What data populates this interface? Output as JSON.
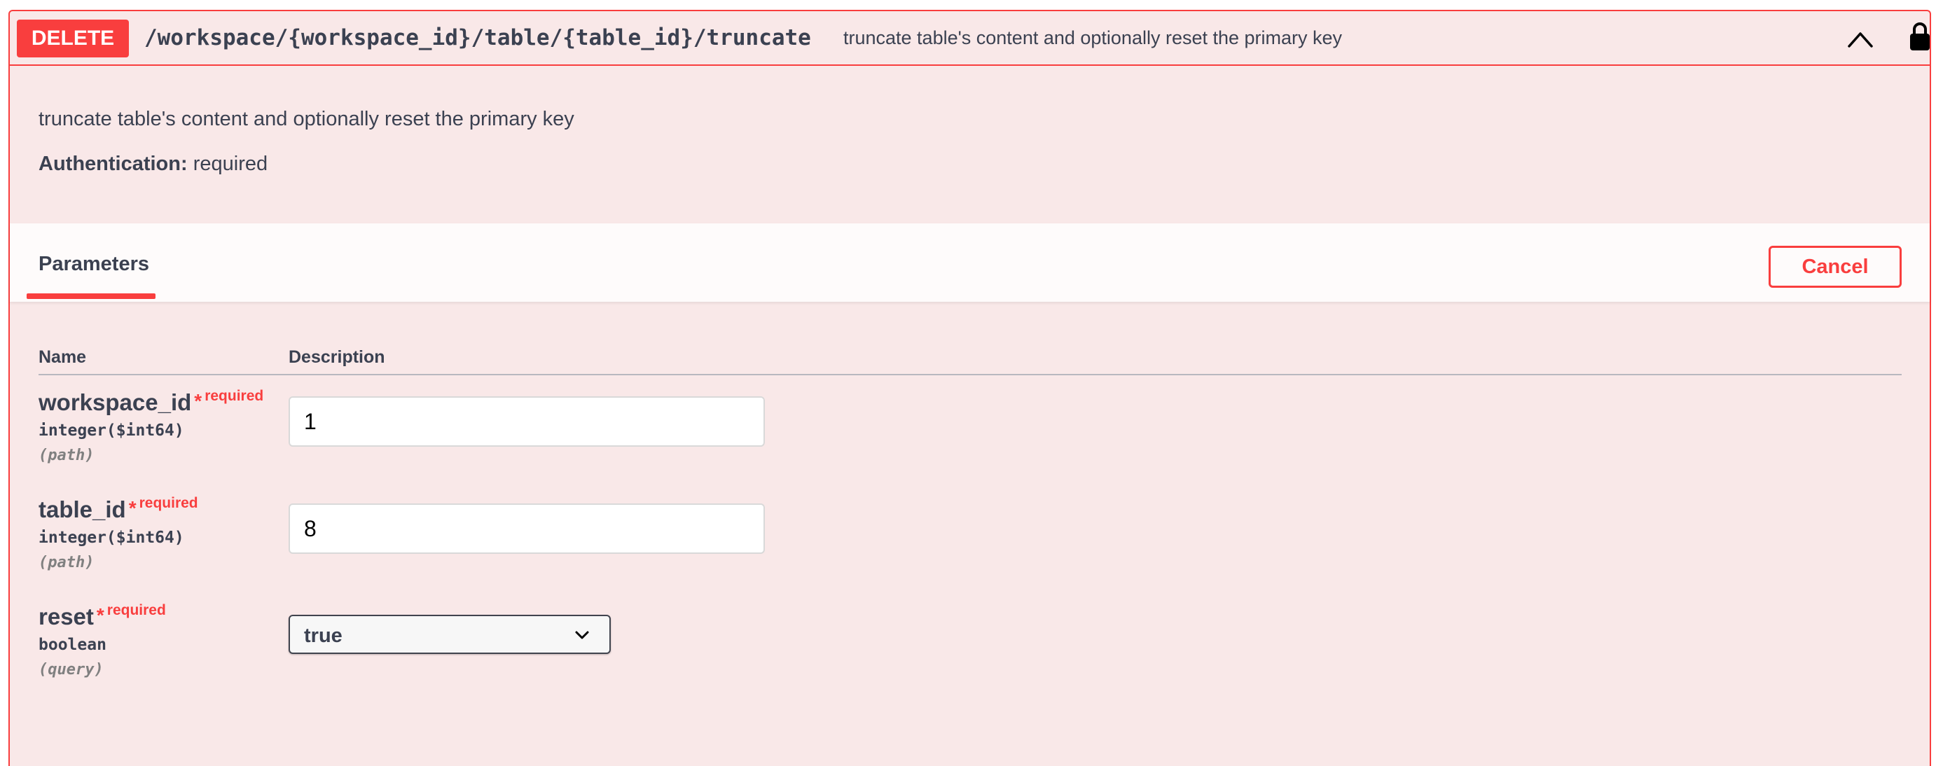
{
  "summary": {
    "method": "DELETE",
    "path": "/workspace/{workspace_id}/table/{table_id}/truncate",
    "description": "truncate table's content and optionally reset the primary key"
  },
  "description": "truncate table's content and optionally reset the primary key",
  "auth": {
    "label": "Authentication:",
    "value": "required"
  },
  "tabs": {
    "parameters": "Parameters",
    "cancel": "Cancel"
  },
  "columns": {
    "name": "Name",
    "description": "Description"
  },
  "parameters": [
    {
      "name": "workspace_id",
      "required": "required",
      "type": "integer($int64)",
      "in": "(path)",
      "value": "1"
    },
    {
      "name": "table_id",
      "required": "required",
      "type": "integer($int64)",
      "in": "(path)",
      "value": "8"
    },
    {
      "name": "reset",
      "required": "required",
      "type": "boolean",
      "in": "(query)",
      "value": "true"
    }
  ],
  "colors": {
    "delete": "#f93e3e",
    "background": "#f9e8e8"
  },
  "icons": {
    "collapse": "chevron-up-icon",
    "auth": "lock-icon",
    "select": "chevron-down-icon"
  }
}
